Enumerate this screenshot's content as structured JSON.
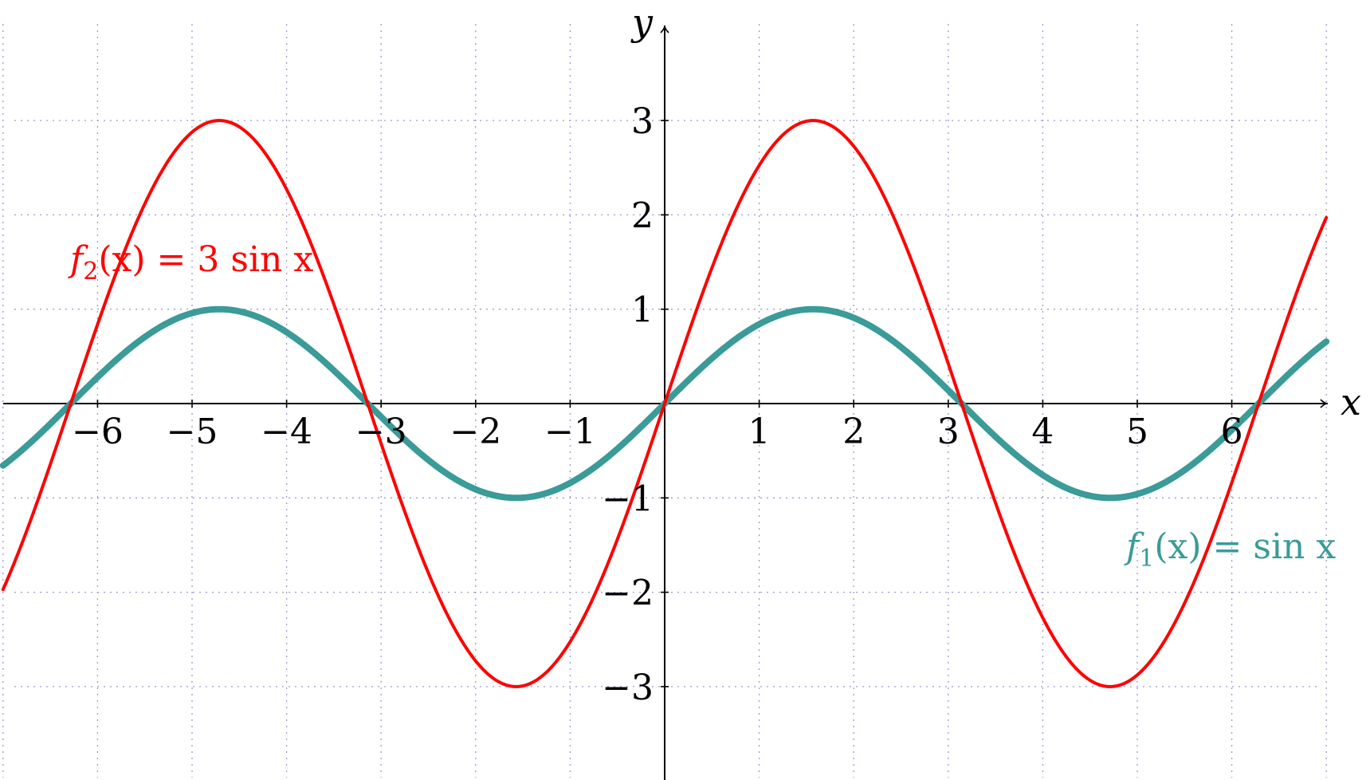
{
  "chart_data": {
    "type": "line",
    "title": "",
    "xlabel": "x",
    "ylabel": "y",
    "xlim": [
      -7,
      7
    ],
    "ylim": [
      -4,
      4
    ],
    "grid": true,
    "x_ticks": [
      -6,
      -5,
      -4,
      -3,
      -2,
      -1,
      1,
      2,
      3,
      4,
      5,
      6
    ],
    "x_tick_labels": [
      "−6",
      "−5",
      "−4",
      "−3",
      "−2",
      "−1",
      "1",
      "2",
      "3",
      "4",
      "5",
      "6"
    ],
    "y_ticks": [
      -3,
      -2,
      -1,
      1,
      2,
      3
    ],
    "y_tick_labels": [
      "−3",
      "−2",
      "−1",
      "1",
      "2",
      "3"
    ],
    "series": [
      {
        "name": "f₁(x) = sin x",
        "label_parts": [
          "f",
          "1",
          "(x) = sin x"
        ],
        "function": "sin x",
        "amplitude": 1,
        "color": "#3a9b98",
        "x_range": [
          -7,
          7
        ],
        "x_samples": [
          -6.283,
          -4.712,
          -3.142,
          -1.571,
          0,
          1.571,
          3.142,
          4.712,
          6.283
        ],
        "y_samples": [
          0,
          1,
          0,
          -1,
          0,
          1,
          0,
          -1,
          0
        ]
      },
      {
        "name": "f₂(x) = 3 sin x",
        "label_parts": [
          "f",
          "2",
          "(x) = 3 sin x"
        ],
        "function": "3 sin x",
        "amplitude": 3,
        "color": "#ff0000",
        "x_range": [
          -7,
          7
        ],
        "x_samples": [
          -6.283,
          -4.712,
          -3.142,
          -1.571,
          0,
          1.571,
          3.142,
          4.712,
          6.283
        ],
        "y_samples": [
          0,
          3,
          0,
          -3,
          0,
          3,
          0,
          -3,
          0
        ]
      }
    ]
  }
}
